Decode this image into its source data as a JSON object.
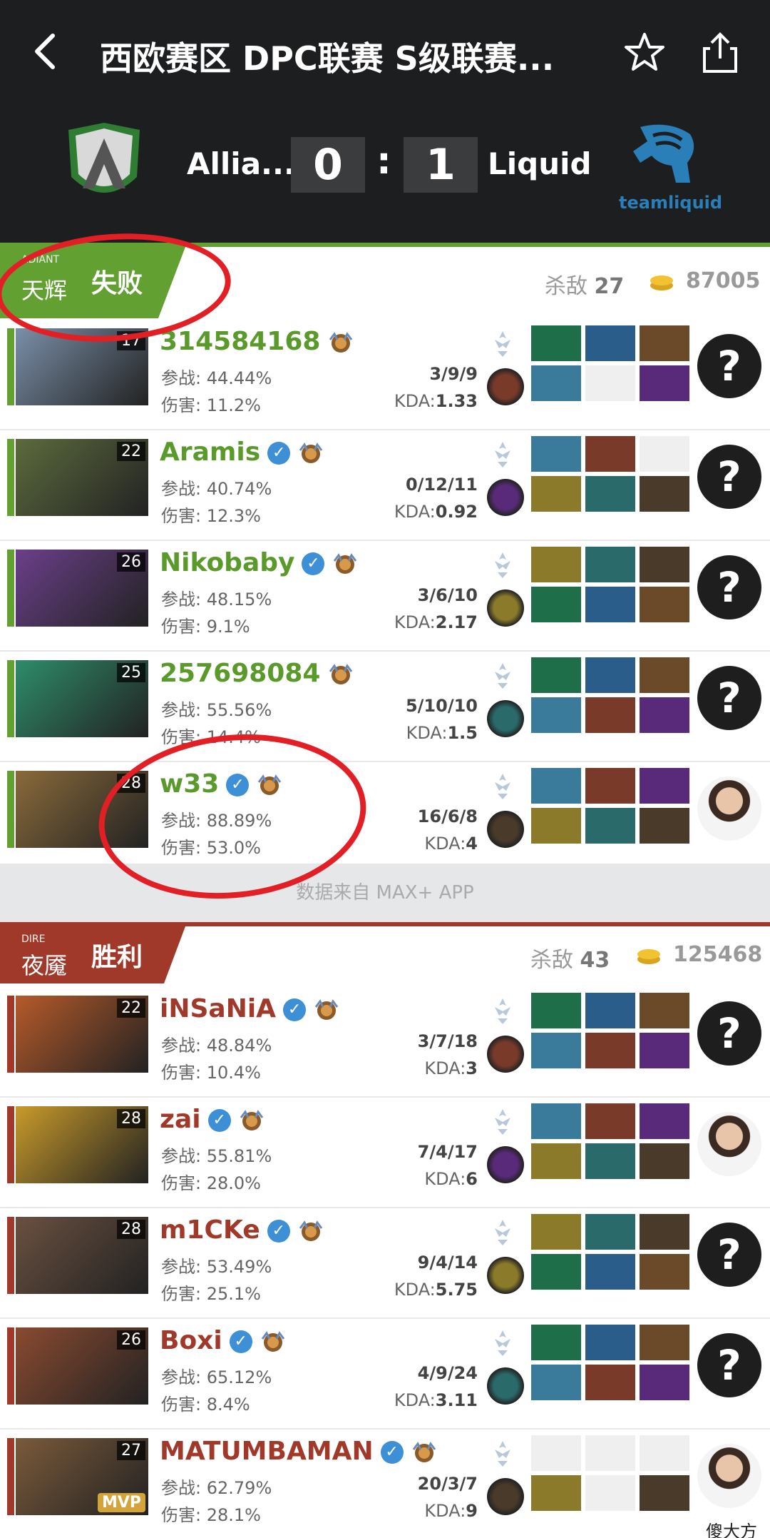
{
  "header": {
    "title": "西欧赛区 DPC联赛 S级联赛...",
    "team_left": "Allia...",
    "team_right": "Liquid",
    "score_left": "0",
    "score_right": "1",
    "colon": ":",
    "logo_right_text": "teamliquid"
  },
  "radiant": {
    "side_en": "ADIANT",
    "side_cn": "天辉",
    "result": "失败",
    "kills_label": "杀敌",
    "kills": "27",
    "gold": "87005",
    "color": "#62a032",
    "players": [
      {
        "name": "314584168",
        "level": "17",
        "verified": false,
        "rate_label": "参战:",
        "rate": "44.44%",
        "dmg_label": "伤害:",
        "dmg": "11.2%",
        "score": "3/9/9",
        "kda_label": "KDA:",
        "kda": "1.33",
        "avatar": "unknown"
      },
      {
        "name": "Aramis",
        "level": "22",
        "verified": true,
        "rate_label": "参战:",
        "rate": "40.74%",
        "dmg_label": "伤害:",
        "dmg": "12.3%",
        "score": "0/12/11",
        "kda_label": "KDA:",
        "kda": "0.92",
        "avatar": "unknown"
      },
      {
        "name": "Nikobaby",
        "level": "26",
        "verified": true,
        "rate_label": "参战:",
        "rate": "48.15%",
        "dmg_label": "伤害:",
        "dmg": "9.1%",
        "score": "3/6/10",
        "kda_label": "KDA:",
        "kda": "2.17",
        "avatar": "unknown"
      },
      {
        "name": "257698084",
        "level": "25",
        "verified": false,
        "rate_label": "参战:",
        "rate": "55.56%",
        "dmg_label": "伤害:",
        "dmg": "14.4%",
        "score": "5/10/10",
        "kda_label": "KDA:",
        "kda": "1.5",
        "avatar": "unknown"
      },
      {
        "name": "w33",
        "level": "28",
        "verified": true,
        "rate_label": "参战:",
        "rate": "88.89%",
        "dmg_label": "伤害:",
        "dmg": "53.0%",
        "score": "16/6/8",
        "kda_label": "KDA:",
        "kda": "4",
        "avatar": "photo"
      }
    ]
  },
  "data_source": "数据来自 MAX+ APP",
  "dire": {
    "side_en": "DIRE",
    "side_cn": "夜魇",
    "result": "胜利",
    "kills_label": "杀敌",
    "kills": "43",
    "gold": "125468",
    "color": "#a0392a",
    "players": [
      {
        "name": "iNSaNiA",
        "level": "22",
        "verified": true,
        "rate_label": "参战:",
        "rate": "48.84%",
        "dmg_label": "伤害:",
        "dmg": "10.4%",
        "score": "3/7/18",
        "kda_label": "KDA:",
        "kda": "3",
        "avatar": "unknown"
      },
      {
        "name": "zai",
        "level": "28",
        "verified": true,
        "rate_label": "参战:",
        "rate": "55.81%",
        "dmg_label": "伤害:",
        "dmg": "28.0%",
        "score": "7/4/17",
        "kda_label": "KDA:",
        "kda": "6",
        "avatar": "photo"
      },
      {
        "name": "m1CKe",
        "level": "28",
        "verified": true,
        "rate_label": "参战:",
        "rate": "53.49%",
        "dmg_label": "伤害:",
        "dmg": "25.1%",
        "score": "9/4/14",
        "kda_label": "KDA:",
        "kda": "5.75",
        "avatar": "unknown"
      },
      {
        "name": "Boxi",
        "level": "26",
        "verified": true,
        "rate_label": "参战:",
        "rate": "65.12%",
        "dmg_label": "伤害:",
        "dmg": "8.4%",
        "score": "4/9/24",
        "kda_label": "KDA:",
        "kda": "3.11",
        "avatar": "unknown"
      },
      {
        "name": "MATUMBAMAN",
        "level": "27",
        "verified": true,
        "mvp": "MVP",
        "rate_label": "参战:",
        "rate": "62.79%",
        "dmg_label": "伤害:",
        "dmg": "28.1%",
        "score": "20/3/7",
        "kda_label": "KDA:",
        "kda": "9",
        "avatar": "photo"
      }
    ]
  },
  "watermark": "傻大方"
}
